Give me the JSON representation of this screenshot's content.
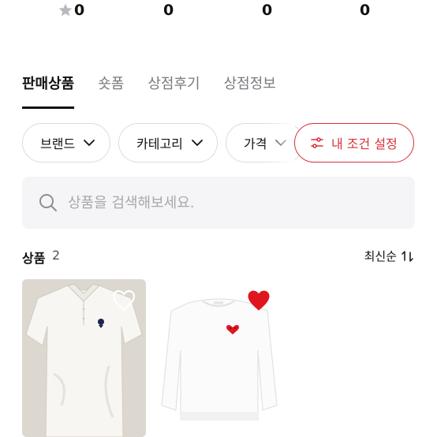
{
  "stats": {
    "rating": "0",
    "stat2": "0",
    "stat3": "0",
    "stat4": "0"
  },
  "tabs": [
    "판매상품",
    "숏폼",
    "상점후기",
    "상점정보"
  ],
  "filters": {
    "brand": "브랜드",
    "category": "카테고리",
    "price": "가격",
    "custom": "내 조건 설정"
  },
  "search": {
    "placeholder": "상품을 검색해보세요."
  },
  "products": {
    "title": "상품",
    "count": "2",
    "sort_label": "최신순"
  },
  "items": [
    {
      "image": "white-polo-shirt",
      "liked": false
    },
    {
      "image": "white-sweatshirt-red-heart",
      "liked": true
    }
  ],
  "colors": {
    "accent": "#d8313a",
    "heart": "#e0161e"
  }
}
